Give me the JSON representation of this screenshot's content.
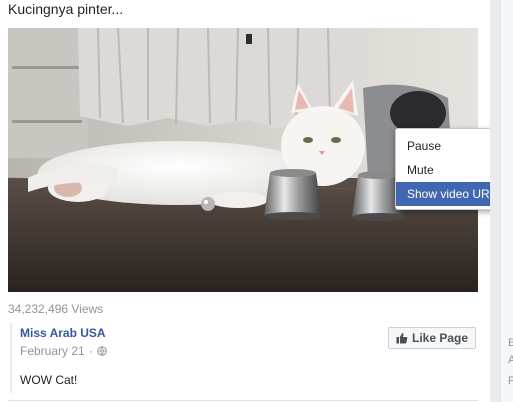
{
  "post": {
    "text": "Kucingnya pinter..."
  },
  "video": {
    "views": "34,232,496 Views"
  },
  "attribution": {
    "page_name": "Miss Arab USA",
    "date": "February 21",
    "separator": "·",
    "privacy_icon": "globe-icon",
    "caption": "WOW Cat!"
  },
  "like_page": {
    "label": "Like Page",
    "icon": "thumbs-up-icon"
  },
  "context_menu": {
    "items": [
      {
        "label": "Pause"
      },
      {
        "label": "Mute"
      },
      {
        "label": "Show video URL"
      }
    ]
  },
  "sidebar": {
    "letters": [
      "E",
      "A",
      "F"
    ]
  },
  "colors": {
    "link": "#365899",
    "menu_highlight": "#4267b2",
    "muted_text": "#90949c"
  }
}
